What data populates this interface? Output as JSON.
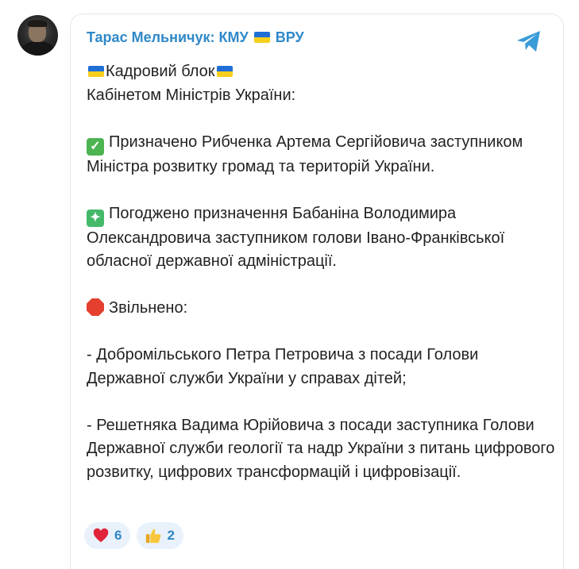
{
  "channel": {
    "name_part1": "Тарас Мельничук: КМУ",
    "name_part2": "ВРУ",
    "flag_icon": "ukraine-flag-icon"
  },
  "message": {
    "header_line1": "Кадровий блок",
    "header_line2": "Кабінетом Міністрів України:",
    "appointed": "Призначено Рибченка Артема Сергійовича заступником Міністра розвитку громад та територій України.",
    "agreed": "Погоджено призначення Бабаніна Володимира Олександровича заступником голови Івано-Франківської обласної державної адміністрації.",
    "dismissed_label": "Звільнено:",
    "dismissed_1": "- Добромільського Петра Петровича з посади Голови Державної служби України у справах дітей;",
    "dismissed_2": "- Решетняка Вадима Юрійовича з посади заступника Голови Державної служби геології та надр України з питань цифрового розвитку, цифрових трансформацій і цифровізації."
  },
  "reactions": [
    {
      "icon": "heart-icon",
      "count": "6"
    },
    {
      "icon": "thumbs-up-icon",
      "count": "2"
    }
  ],
  "colors": {
    "accent": "#2f88c8",
    "reaction_bg": "#e9f2fa",
    "text": "#222222"
  }
}
